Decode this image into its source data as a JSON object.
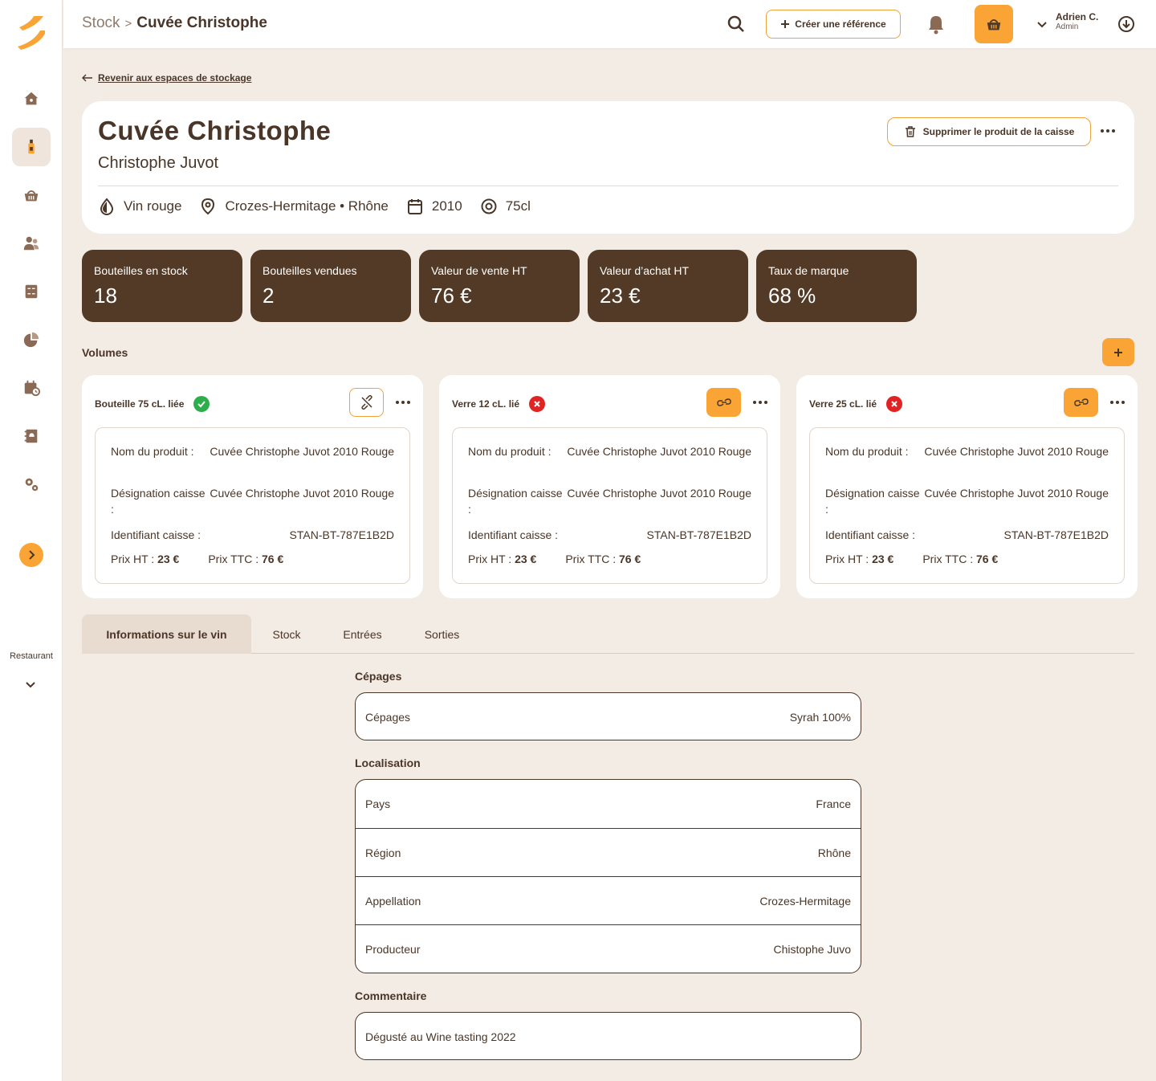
{
  "sidebar": {
    "items": [
      {
        "icon": "home-icon"
      },
      {
        "icon": "bottle-icon",
        "active": true
      },
      {
        "icon": "basket-icon"
      },
      {
        "icon": "users-icon"
      },
      {
        "icon": "calculator-icon"
      },
      {
        "icon": "pie-chart-icon"
      },
      {
        "icon": "calendar-clock-icon"
      },
      {
        "icon": "menu-book-icon"
      },
      {
        "icon": "settings-icon"
      }
    ],
    "restaurant_label": "Restaurant"
  },
  "topbar": {
    "breadcrumb_root": "Stock",
    "breadcrumb_current": "Cuvée Christophe",
    "create_label": "Créer une référence",
    "user_name": "Adrien C.",
    "user_role": "Admin"
  },
  "back_link": "Revenir aux espaces de stockage",
  "product": {
    "title": "Cuvée Christophe",
    "producer": "Christophe Juvot",
    "delete_label": "Supprimer le produit de la caisse",
    "type": "Vin rouge",
    "location": "Crozes-Hermitage • Rhône",
    "vintage": "2010",
    "volume": "75cl"
  },
  "stats": [
    {
      "label": "Bouteilles en stock",
      "value": "18"
    },
    {
      "label": "Bouteilles vendues",
      "value": "2"
    },
    {
      "label": "Valeur de vente HT",
      "value": "76 €"
    },
    {
      "label": "Valeur d’achat HT",
      "value": "23 €"
    },
    {
      "label": "Taux de marque",
      "value": "68 %"
    }
  ],
  "volumes": {
    "title": "Volumes",
    "cards": [
      {
        "title": "Bouteille 75 cL. liée",
        "linked": true,
        "name_label": "Nom du produit :",
        "name_value": "Cuvée  Christophe Juvot 2010 Rouge",
        "designation_label": "Désignation caisse :",
        "designation_value": "Cuvée  Christophe Juvot 2010 Rouge",
        "id_label": "Identifiant caisse :",
        "id_value": "STAN-BT-787E1B2D",
        "ht_label": "Prix HT :",
        "ht_value": "23 €",
        "ttc_label": "Prix TTC :",
        "ttc_value": "76 €"
      },
      {
        "title": "Verre 12 cL. lié",
        "linked": false,
        "name_label": "Nom du produit :",
        "name_value": "Cuvée  Christophe Juvot 2010 Rouge",
        "designation_label": "Désignation caisse :",
        "designation_value": "Cuvée  Christophe Juvot 2010 Rouge",
        "id_label": "Identifiant caisse :",
        "id_value": "STAN-BT-787E1B2D",
        "ht_label": "Prix HT :",
        "ht_value": "23 €",
        "ttc_label": "Prix TTC :",
        "ttc_value": "76 €"
      },
      {
        "title": "Verre 25 cL. lié",
        "linked": false,
        "name_label": "Nom du produit :",
        "name_value": "Cuvée  Christophe Juvot 2010 Rouge",
        "designation_label": "Désignation caisse :",
        "designation_value": "Cuvée  Christophe Juvot 2010 Rouge",
        "id_label": "Identifiant caisse :",
        "id_value": "STAN-BT-787E1B2D",
        "ht_label": "Prix HT :",
        "ht_value": "23 €",
        "ttc_label": "Prix TTC :",
        "ttc_value": "76 €"
      }
    ]
  },
  "tabs": [
    {
      "label": "Informations sur le vin",
      "active": true
    },
    {
      "label": "Stock"
    },
    {
      "label": "Entrées"
    },
    {
      "label": "Sorties"
    }
  ],
  "wine_info": {
    "cepages_title": "Cépages",
    "cepages": [
      {
        "label": "Cépages",
        "value": "Syrah 100%"
      }
    ],
    "localisation_title": "Localisation",
    "localisation": [
      {
        "label": "Pays",
        "value": "France"
      },
      {
        "label": "Région",
        "value": "Rhône"
      },
      {
        "label": "Appellation",
        "value": "Crozes-Hermitage"
      },
      {
        "label": "Producteur",
        "value": "Chistophe Juvo"
      }
    ],
    "comment_title": "Commentaire",
    "comment": "Dégusté au Wine tasting 2022"
  },
  "colors": {
    "accent": "#f9a434",
    "dark_brown": "#533a26",
    "text": "#4a3628",
    "background": "#f3ece5",
    "success": "#2eae4b",
    "error": "#e02424"
  }
}
